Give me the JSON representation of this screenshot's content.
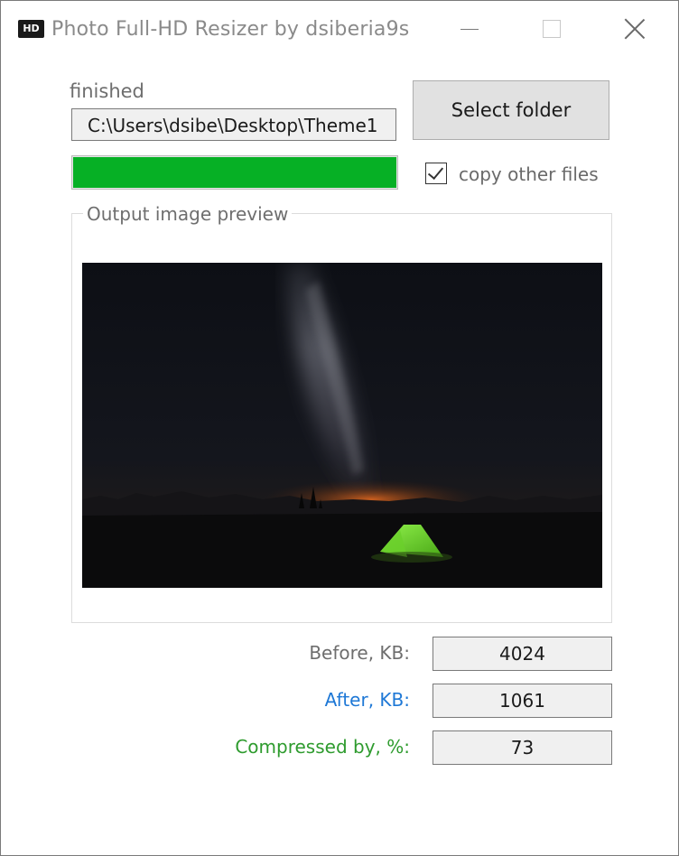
{
  "window": {
    "title": "Photo Full-HD Resizer by dsiberia9s",
    "icon": "hd-app-icon"
  },
  "status": "finished",
  "path_value": "C:\\Users\\dsibe\\Desktop\\Theme1",
  "select_button_label": "Select folder",
  "progress_value": 1.0,
  "progress_color": "#06b025",
  "copy_other_files": {
    "label": "copy other files",
    "checked": true
  },
  "preview": {
    "group_title": "Output image preview"
  },
  "stats": {
    "before_label": "Before, KB:",
    "before_value": "4024",
    "before_color": "#6e6e6e",
    "after_label": "After, KB:",
    "after_value": "1061",
    "after_color": "#1e78d6",
    "compressed_label": "Compressed by, %:",
    "compressed_value": "73",
    "compressed_color": "#2e9b2e"
  }
}
